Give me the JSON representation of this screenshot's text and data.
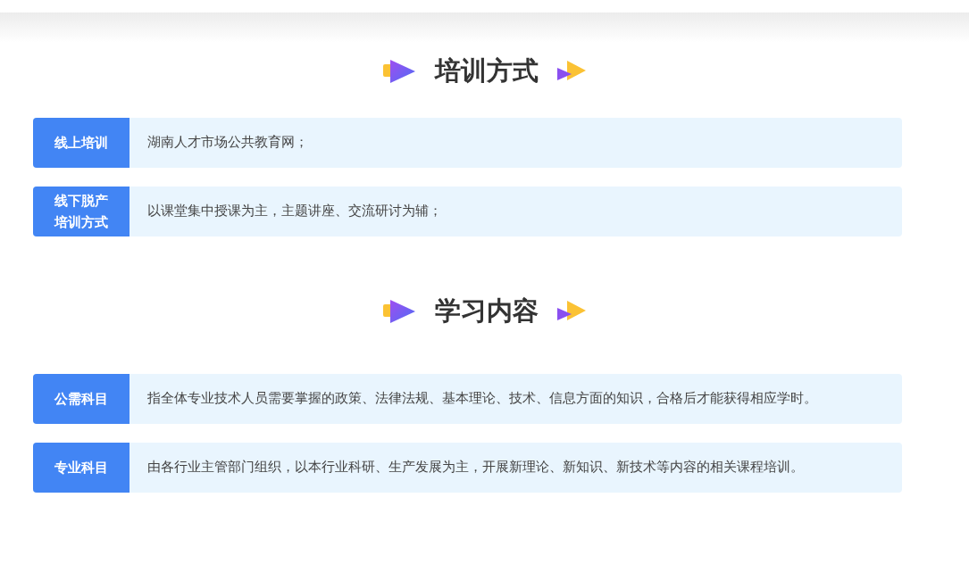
{
  "sections": [
    {
      "title": "培训方式",
      "rows": [
        {
          "label": "线上培训",
          "text": "湖南人才市场公共教育网；"
        },
        {
          "label": "线下脱产培训方式",
          "text": "以课堂集中授课为主，主题讲座、交流研讨为辅；"
        }
      ]
    },
    {
      "title": "学习内容",
      "rows": [
        {
          "label": "公需科目",
          "text": "指全体专业技术人员需要掌握的政策、法律法规、基本理论、技术、信息方面的知识，合格后才能获得相应学时。"
        },
        {
          "label": "专业科目",
          "text": "由各行业主管部门组织，以本行业科研、生产发展为主，开展新理论、新知识、新技术等内容的相关课程培训。"
        }
      ]
    }
  ]
}
